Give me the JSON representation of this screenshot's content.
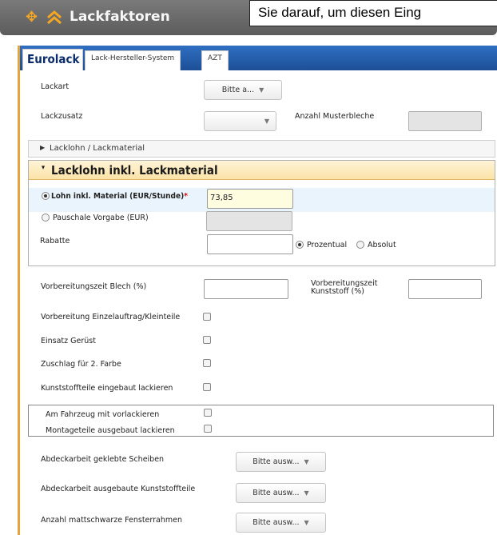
{
  "window": {
    "title": "Lackfaktoren",
    "move_icon": "move-arrows-icon",
    "collapse_icon": "double-chevron-up-icon",
    "tooltip": "Sie darauf, um diesen Eing"
  },
  "tabs": [
    {
      "label": "Eurolack",
      "active": true
    },
    {
      "label": "Lack-Hersteller-System",
      "active": false
    },
    {
      "label": "AZT",
      "active": false
    }
  ],
  "form": {
    "lackart": {
      "label": "Lackart",
      "value": "Bitte a..."
    },
    "lackzusatz": {
      "label": "Lackzusatz",
      "value": ""
    },
    "anzahl_musterbleche": {
      "label": "Anzahl Musterbleche",
      "value": ""
    },
    "accordion_collapsed": {
      "label": "Lacklohn / Lackmaterial"
    },
    "accordion_open": {
      "label": "Lacklohn inkl. Lackmaterial",
      "lohn": {
        "label": "Lohn inkl. Material (EUR/Stunde)",
        "required_mark": "*",
        "value": "73,85",
        "selected": true
      },
      "pauschale": {
        "label": "Pauschale Vorgabe (EUR)",
        "value": "",
        "selected": false
      },
      "rabatte": {
        "label": "Rabatte",
        "value": "",
        "option_prozentual": "Prozentual",
        "option_absolut": "Absolut",
        "selected": "Prozentual"
      }
    },
    "vorbereitungszeit_blech": {
      "label": "Vorbereitungszeit Blech (%)",
      "value": ""
    },
    "vorbereitungszeit_kunststoff": {
      "label_line1": "Vorbereitungszeit",
      "label_line2": "Kunststoff (%)",
      "value": ""
    },
    "checkboxes": [
      {
        "label": "Vorbereitung Einzelauftrag/Kleinteile",
        "checked": false
      },
      {
        "label": "Einsatz Gerüst",
        "checked": false
      },
      {
        "label": "Zuschlag für 2. Farbe",
        "checked": false
      },
      {
        "label": "Kunststoffteile eingebaut lackieren",
        "checked": false
      }
    ],
    "framed_checkboxes": [
      {
        "label": "Am Fahrzeug mit vorlackieren",
        "checked": false
      },
      {
        "label": "Montageteile ausgebaut lackieren",
        "checked": false
      }
    ],
    "selects": [
      {
        "label": "Abdeckarbeit geklebte Scheiben",
        "value": "Bitte ausw..."
      },
      {
        "label": "Abdeckarbeit ausgebaute Kunststoffteile",
        "value": "Bitte ausw..."
      },
      {
        "label": "Anzahl mattschwarze Fensterrahmen",
        "value": "Bitte ausw..."
      }
    ]
  },
  "colors": {
    "tab_bar": "#1d4f96",
    "accent_orange": "#e8a33d",
    "title_bar": "#666666",
    "required": "#dd0000"
  }
}
